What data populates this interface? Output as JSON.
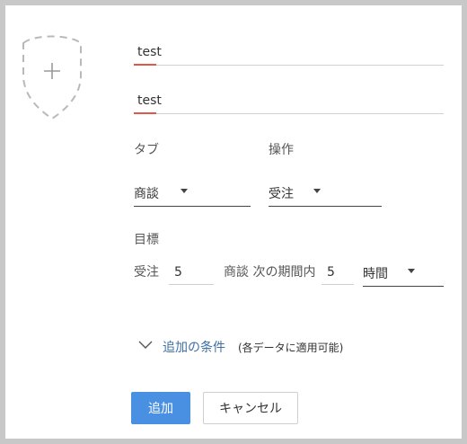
{
  "form": {
    "name_field": {
      "value": "test"
    },
    "desc_field": {
      "value": "test"
    },
    "tab": {
      "label": "タブ",
      "selected": "商談"
    },
    "operation": {
      "label": "操作",
      "selected": "受注"
    },
    "goal": {
      "label": "目標",
      "action_label": "受注",
      "count": "5",
      "object_label": "商談 次の期間内",
      "period_count": "5",
      "period_unit": "時間"
    },
    "additional_conditions": {
      "link": "追加の条件",
      "note": "(各データに適用可能)"
    },
    "buttons": {
      "add": "追加",
      "cancel": "キャンセル"
    }
  },
  "colors": {
    "primary": "#4a90e2",
    "link": "#3f6fa4",
    "accent": "#e0584a"
  }
}
